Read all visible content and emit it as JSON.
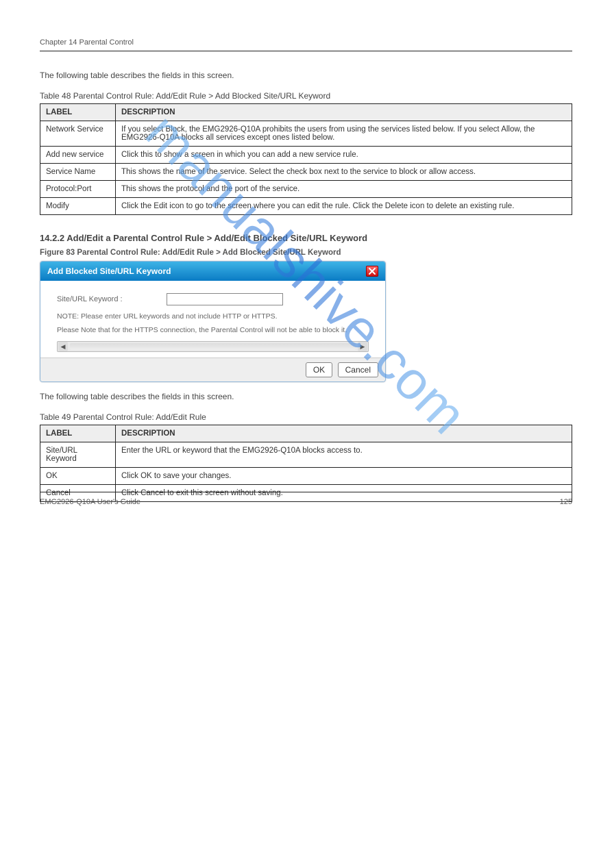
{
  "header": {
    "chapter": "Chapter 14 Parental Control",
    "right": ""
  },
  "intro": "The following table describes the fields in this screen.",
  "table1": {
    "caption": "Table 48   Parental Control Rule: Add/Edit Rule > Add Blocked Site/URL Keyword",
    "headers": [
      "LABEL",
      "DESCRIPTION"
    ],
    "rows": [
      {
        "label": "Network Service",
        "desc": "If you select Block, the EMG2926-Q10A prohibits the users from using the services listed below. If you select Allow, the EMG2926-Q10A blocks all services except ones listed below."
      },
      {
        "label": "Add new service",
        "desc": "Click this to show a screen in which you can add a new service rule."
      },
      {
        "label": "Service Name",
        "desc": "This shows the name of the service. Select the check box next to the service to block or allow access."
      },
      {
        "label": "Protocol:Port",
        "desc": "This shows the protocol and the port of the service."
      },
      {
        "label": "Modify",
        "desc": "Click the Edit icon to go to the screen where you can edit the rule. Click the Delete icon to delete an existing rule."
      }
    ]
  },
  "section2": {
    "heading": "14.2.2  Add/Edit a Parental Control Rule > Add/Edit Blocked Site/URL Keyword",
    "figure": "Figure 83   Parental Control Rule: Add/Edit Rule > Add Blocked Site/URL Keyword",
    "intro": "The following table describes the fields in this screen."
  },
  "dialog": {
    "title": "Add Blocked Site/URL Keyword",
    "label": "Site/URL Keyword :",
    "note1": "NOTE: Please enter URL keywords and not include HTTP or HTTPS.",
    "note2": "Please Note that for the HTTPS connection, the Parental Control will not be able to block it.",
    "ok": "OK",
    "cancel": "Cancel"
  },
  "table2": {
    "caption": "Table 49   Parental Control Rule: Add/Edit Rule",
    "headers": [
      "LABEL",
      "DESCRIPTION"
    ],
    "rows": [
      {
        "label": "Site/URL Keyword",
        "desc": "Enter the URL or keyword that the EMG2926-Q10A blocks access to."
      },
      {
        "label": "OK",
        "desc": "Click OK to save your changes."
      },
      {
        "label": "Cancel",
        "desc": "Click Cancel to exit this screen without saving."
      }
    ]
  },
  "footer": {
    "guide": "EMG2926-Q10A User's Guide",
    "page": "125"
  },
  "watermark": "manualshive.com"
}
